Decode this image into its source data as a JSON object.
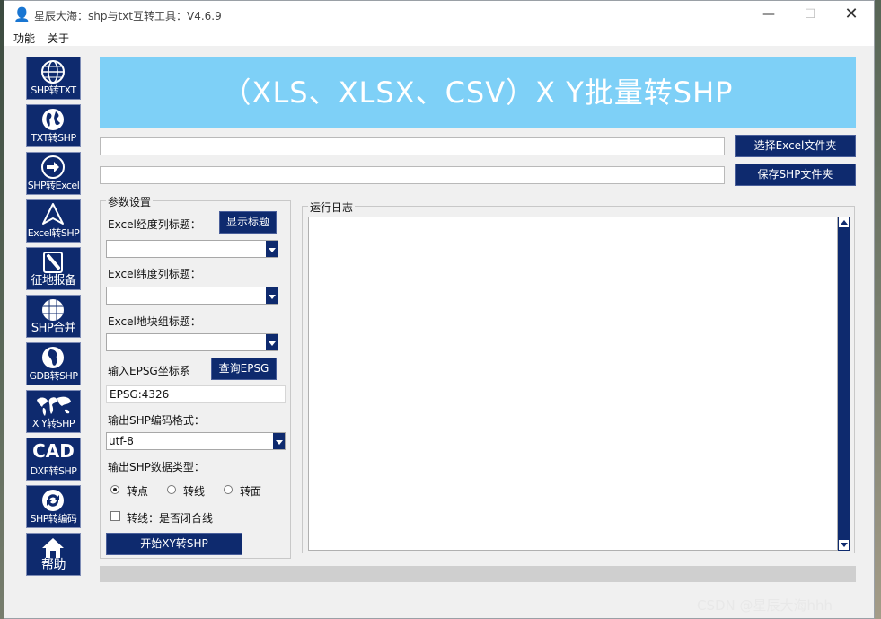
{
  "window": {
    "title": "星辰大海：shp与txt互转工具：V4.6.9",
    "app_icon": "goku-icon",
    "minimize": "—",
    "maximize": "☐",
    "close": "✕"
  },
  "menu": {
    "items": [
      "功能",
      "关于"
    ]
  },
  "sidebar": {
    "items": [
      {
        "label": "SHP转TXT",
        "icon": "globe-icon"
      },
      {
        "label": "TXT转SHP",
        "icon": "earth-icon"
      },
      {
        "label": "SHP转Excel",
        "icon": "arrow-right-circle-icon"
      },
      {
        "label": "Excel转SHP",
        "icon": "navigation-icon"
      },
      {
        "label": "征地报备",
        "icon": "paperclip-icon"
      },
      {
        "label": "SHP合并",
        "icon": "sphere-grid-icon"
      },
      {
        "label": "GDB转SHP",
        "icon": "globe-africa-icon"
      },
      {
        "label": "X Y转SHP",
        "icon": "world-map-icon"
      },
      {
        "label": "DXF转SHP",
        "icon_text": "CAD"
      },
      {
        "label": "SHP转编码",
        "icon": "refresh-icon"
      },
      {
        "label": "帮助",
        "icon": "home-icon"
      }
    ]
  },
  "banner": {
    "title": "（XLS、XLSX、CSV）X Y批量转SHP"
  },
  "paths": {
    "excel_folder_value": "",
    "shp_folder_value": "",
    "select_excel_button": "选择Excel文件夹",
    "save_shp_button": "保存SHP文件夹"
  },
  "params": {
    "group_title": "参数设置",
    "lon_label": "Excel经度列标题：",
    "show_headers_button": "显示标题",
    "lon_value": "",
    "lat_label": "Excel纬度列标题：",
    "lat_value": "",
    "group_label": "Excel地块组标题：",
    "group_value": "",
    "epsg_label": "输入EPSG坐标系",
    "query_epsg_button": "查询EPSG",
    "epsg_value": "EPSG:4326",
    "encoding_label": "输出SHP编码格式：",
    "encoding_value": "utf-8",
    "type_label": "输出SHP数据类型：",
    "types": [
      {
        "label": "转点",
        "checked": true
      },
      {
        "label": "转线",
        "checked": false
      },
      {
        "label": "转面",
        "checked": false
      }
    ],
    "close_line_label": "转线：是否闭合线",
    "close_line_checked": false,
    "start_button": "开始XY转SHP"
  },
  "log": {
    "title": "运行日志",
    "content": ""
  },
  "progress": {
    "value": 0
  },
  "watermark": "CSDN @星辰大海hhh",
  "colors": {
    "accent": "#0e2a6e",
    "banner": "#7ed0f7",
    "window_bg": "#f0f0f0"
  }
}
